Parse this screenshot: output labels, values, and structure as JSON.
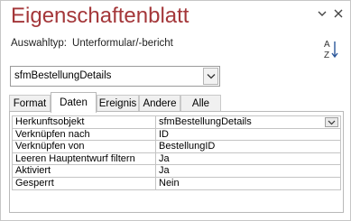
{
  "window": {
    "title": "Eigenschaftenblatt"
  },
  "selection": {
    "label": "Auswahltyp:",
    "value": "Unterformular/-bericht"
  },
  "object_combo": {
    "value": "sfmBestellungDetails"
  },
  "sort_icon_label": "A↓Z",
  "tabs": [
    {
      "label": "Format",
      "active": false
    },
    {
      "label": "Daten",
      "active": true
    },
    {
      "label": "Ereignis",
      "active": false
    },
    {
      "label": "Andere",
      "active": false
    },
    {
      "label": "Alle",
      "active": false
    }
  ],
  "properties": [
    {
      "name": "Herkunftsobjekt",
      "value": "sfmBestellungDetails",
      "has_dropdown": true
    },
    {
      "name": "Verknüpfen nach",
      "value": "ID"
    },
    {
      "name": "Verknüpfen von",
      "value": "BestellungID"
    },
    {
      "name": "Leeren Hauptentwurf filtern",
      "value": "Ja"
    },
    {
      "name": "Aktiviert",
      "value": "Ja"
    },
    {
      "name": "Gesperrt",
      "value": "Nein"
    }
  ]
}
